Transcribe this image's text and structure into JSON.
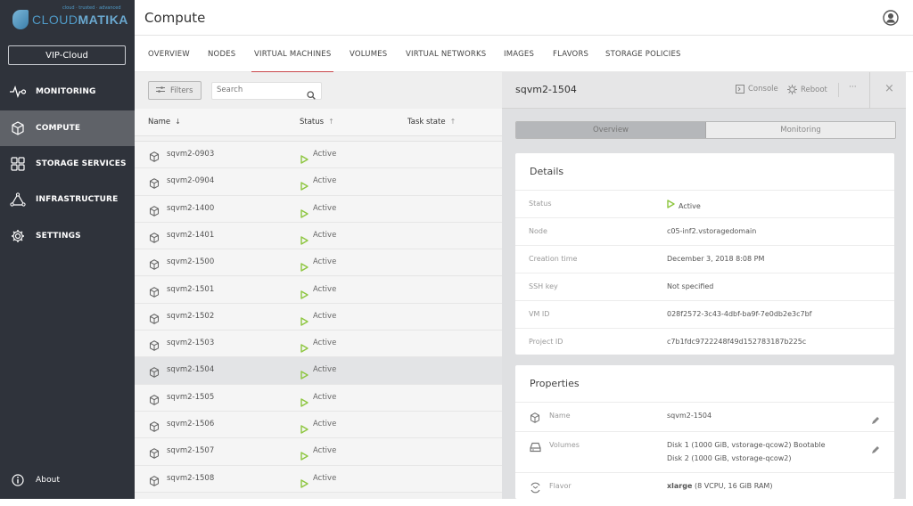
{
  "sidebar": {
    "logo_text_a": "CLOUD",
    "logo_text_b": "MATIKA",
    "logo_tagline": "cloud · trusted · advanced",
    "project": "VIP-Cloud",
    "items": [
      {
        "label": "MONITORING",
        "icon": "pulse-icon"
      },
      {
        "label": "COMPUTE",
        "icon": "cube-icon",
        "active": true
      },
      {
        "label": "STORAGE SERVICES",
        "icon": "grid-icon"
      },
      {
        "label": "INFRASTRUCTURE",
        "icon": "triangle-nodes-icon"
      },
      {
        "label": "SETTINGS",
        "icon": "gear-icon"
      }
    ],
    "about": "About"
  },
  "header": {
    "title": "Compute"
  },
  "tabs": [
    {
      "label": "OVERVIEW"
    },
    {
      "label": "NODES"
    },
    {
      "label": "VIRTUAL MACHINES",
      "active": true
    },
    {
      "label": "VOLUMES"
    },
    {
      "label": "VIRTUAL NETWORKS"
    },
    {
      "label": "IMAGES"
    },
    {
      "label": "FLAVORS"
    },
    {
      "label": "STORAGE POLICIES"
    }
  ],
  "list": {
    "filters_label": "Filters",
    "search_placeholder": "Search",
    "columns": {
      "name": "Name",
      "name_sort": "↓",
      "status": "Status",
      "status_sort": "↑",
      "task": "Task state",
      "task_sort": "↑"
    },
    "rows": [
      {
        "name": "sqvm2-0903",
        "status": "Active"
      },
      {
        "name": "sqvm2-0904",
        "status": "Active"
      },
      {
        "name": "sqvm2-1400",
        "status": "Active"
      },
      {
        "name": "sqvm2-1401",
        "status": "Active"
      },
      {
        "name": "sqvm2-1500",
        "status": "Active"
      },
      {
        "name": "sqvm2-1501",
        "status": "Active"
      },
      {
        "name": "sqvm2-1502",
        "status": "Active"
      },
      {
        "name": "sqvm2-1503",
        "status": "Active"
      },
      {
        "name": "sqvm2-1504",
        "status": "Active",
        "selected": true
      },
      {
        "name": "sqvm2-1505",
        "status": "Active"
      },
      {
        "name": "sqvm2-1506",
        "status": "Active"
      },
      {
        "name": "sqvm2-1507",
        "status": "Active"
      },
      {
        "name": "sqvm2-1508",
        "status": "Active"
      }
    ]
  },
  "detail": {
    "title": "sqvm2-1504",
    "console": "Console",
    "reboot": "Reboot",
    "more": "···",
    "close": "×",
    "segments": {
      "overview": "Overview",
      "monitoring": "Monitoring"
    },
    "details_title": "Details",
    "details": [
      {
        "key": "Status",
        "value": "Active"
      },
      {
        "key": "Node",
        "value": "c05-inf2.vstoragedomain"
      },
      {
        "key": "Creation time",
        "value": "December 3, 2018 8:08 PM"
      },
      {
        "key": "SSH key",
        "value": "Not specified"
      },
      {
        "key": "VM ID",
        "value": "028f2572-3c43-4dbf-ba9f-7e0db2e3c7bf"
      },
      {
        "key": "Project ID",
        "value": "c7b1fdc9722248f49d152783187b225c"
      }
    ],
    "properties_title": "Properties",
    "properties": {
      "name_key": "Name",
      "name_value": "sqvm2-1504",
      "volumes_key": "Volumes",
      "volume1": "Disk 1 (1000 GiB, vstorage-qcow2) Bootable",
      "volume2": "Disk 2 (1000 GiB, vstorage-qcow2)",
      "flavor_key": "Flavor",
      "flavor_name": "xlarge",
      "flavor_spec": "(8 VCPU, 16 GiB RAM)"
    }
  },
  "colors": {
    "sidebar": "#2f333b",
    "active_tab": "#c9474b",
    "status_active": "#8dc63f"
  }
}
